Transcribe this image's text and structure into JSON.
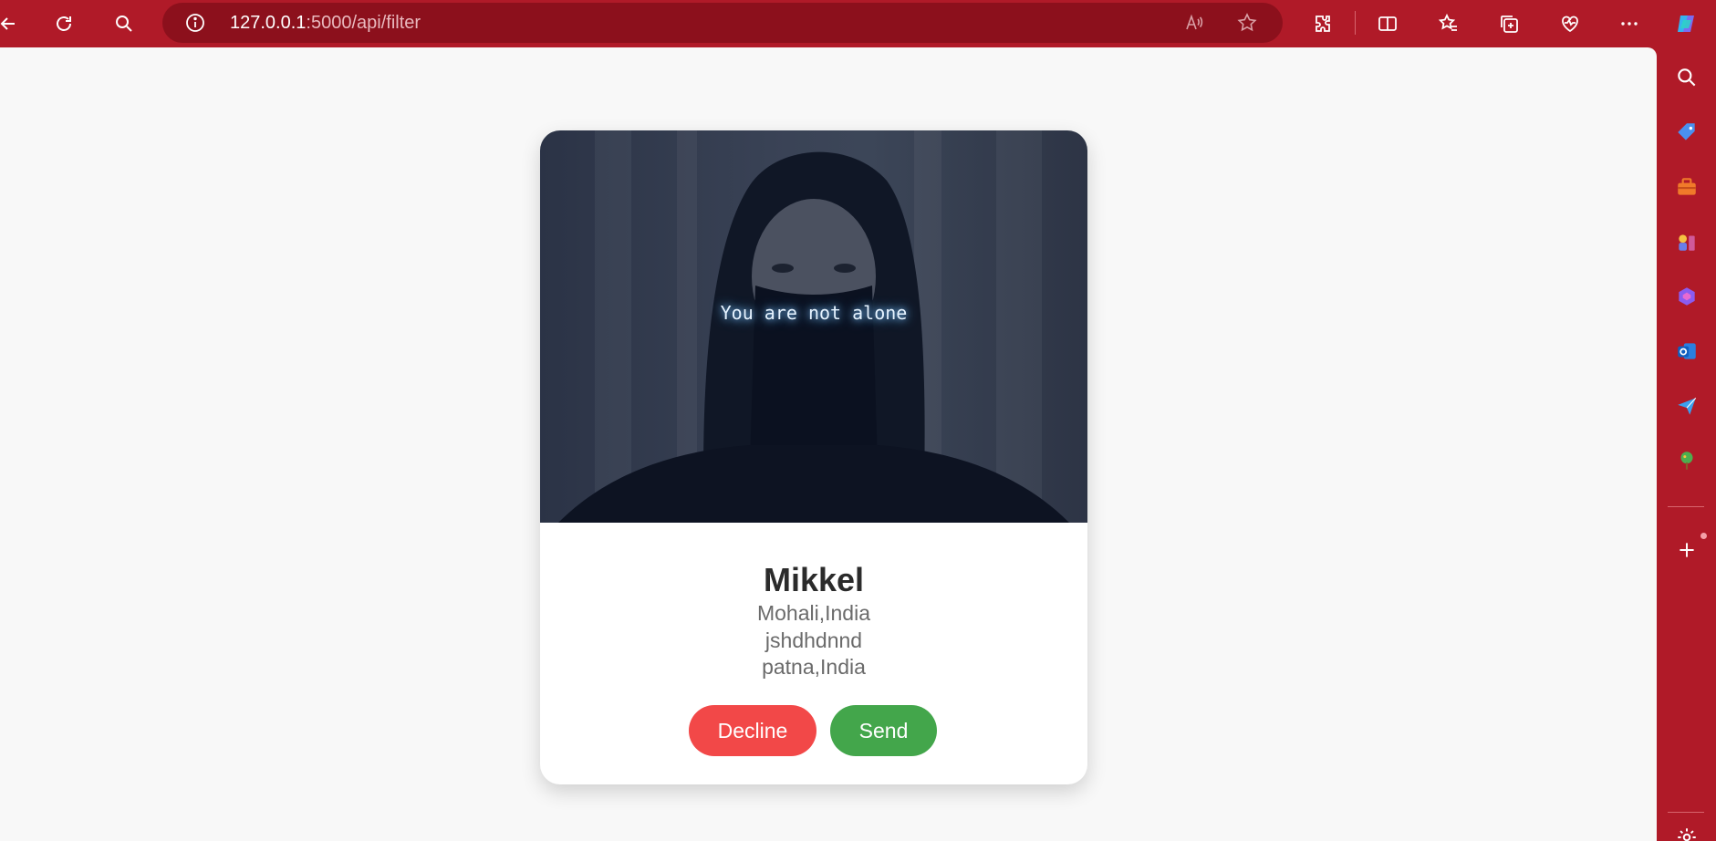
{
  "browser": {
    "address": {
      "host": "127.0.0.1",
      "path": ":5000/api/filter"
    }
  },
  "card": {
    "photo_caption": "You are not alone",
    "name": "Mikkel",
    "lines": [
      "Mohali,India",
      "jshdhdnnd",
      "patna,India"
    ],
    "decline_label": "Decline",
    "send_label": "Send"
  },
  "colors": {
    "browser_frame": "#b01a28",
    "address_bar": "#8c101c",
    "page_background": "#f8f8f8",
    "decline": "#f24848",
    "send": "#43a64b"
  }
}
